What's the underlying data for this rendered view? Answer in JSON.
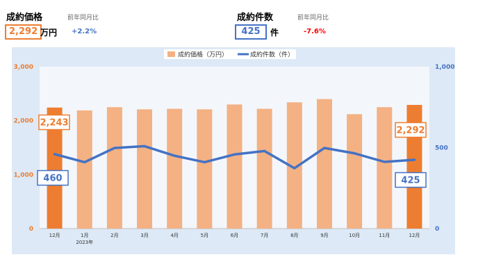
{
  "header": {
    "price": {
      "title": "成約価格",
      "yoy_label": "前年同月比",
      "value": "2,292",
      "unit": "万円",
      "change": "+2.2%"
    },
    "count": {
      "title": "成約件数",
      "yoy_label": "前年同月比",
      "value": "425",
      "unit": "件",
      "change": "-7.6%"
    }
  },
  "colors": {
    "bar": "#f4b183",
    "bar_highlight": "#ed7d31",
    "line": "#4472c4",
    "plot_bg": "#f3f7fc",
    "frame_bg": "#dde9f6",
    "left_axis": "#ed7d31",
    "right_axis": "#4472c4",
    "change_up": "#4472c4",
    "change_down": "#ff0000"
  },
  "chart_data": {
    "type": "bar",
    "categories": [
      "12月",
      "1月",
      "2月",
      "3月",
      "4月",
      "5月",
      "6月",
      "7月",
      "8月",
      "9月",
      "10月",
      "11月",
      "12月"
    ],
    "x_sublabel": "2023年",
    "series": [
      {
        "name": "成約価格（万円）",
        "type": "bar",
        "axis": "left",
        "values": [
          2243,
          2190,
          2250,
          2210,
          2220,
          2210,
          2300,
          2220,
          2340,
          2400,
          2120,
          2250,
          2292
        ]
      },
      {
        "name": "成約件数（件）",
        "type": "line",
        "axis": "right",
        "values": [
          460,
          410,
          498,
          509,
          450,
          410,
          458,
          479,
          373,
          498,
          465,
          412,
          425
        ]
      }
    ],
    "left_axis": {
      "ylim": [
        0,
        3000
      ],
      "ticks": [
        "0",
        "1,000",
        "2,000",
        "3,000"
      ]
    },
    "right_axis": {
      "ylim": [
        0,
        1000
      ],
      "ticks": [
        "0",
        "500",
        "1,000"
      ]
    },
    "highlight_indices": [
      0,
      12
    ],
    "callouts": {
      "first_price": "2,243",
      "first_count": "460",
      "last_price": "2,292",
      "last_count": "425"
    },
    "legend_position": "top",
    "grid": false
  }
}
